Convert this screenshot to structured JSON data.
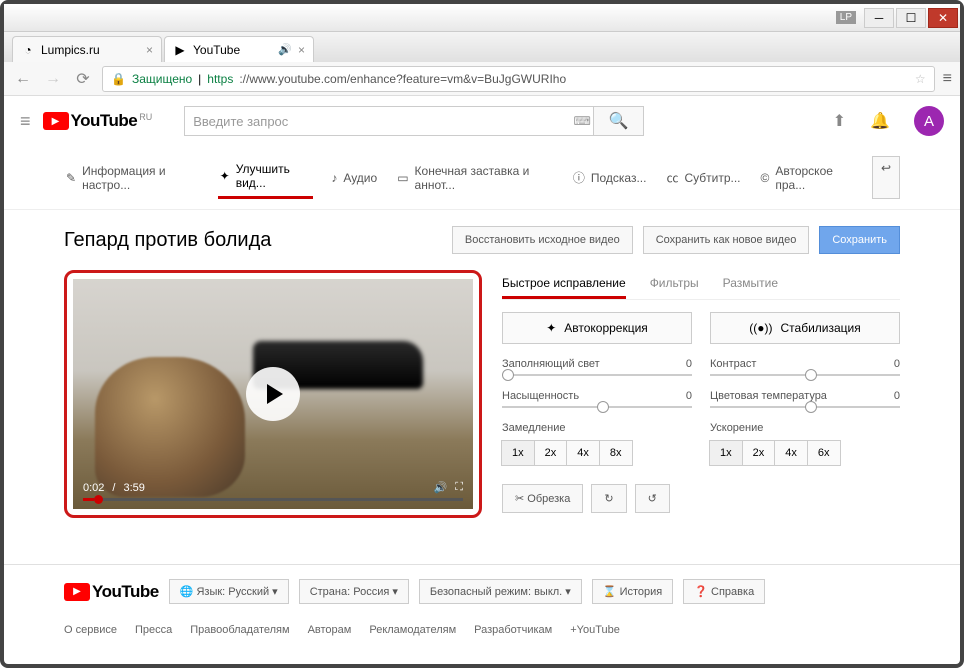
{
  "window": {
    "lp_badge": "LP"
  },
  "tabs": [
    {
      "title": "Lumpics.ru",
      "active": false
    },
    {
      "title": "YouTube",
      "active": true,
      "audio": true
    }
  ],
  "addr": {
    "secure_label": "Защищено",
    "url_host": "https",
    "url_rest": "://www.youtube.com/enhance?feature=vm&v=BuJgGWURIho"
  },
  "yt": {
    "logo_text": "YouTube",
    "region": "RU",
    "search_placeholder": "Введите запрос",
    "avatar_letter": "A"
  },
  "editor_tabs": {
    "info": "Информация и настро...",
    "enhance": "Улучшить вид...",
    "audio": "Аудио",
    "endscreen": "Конечная заставка и аннот...",
    "cards": "Подсказ...",
    "subtitles": "Субтитр...",
    "copyright": "Авторское пра..."
  },
  "video": {
    "title": "Гепард против болида",
    "restore_btn": "Восстановить исходное видео",
    "save_as_new_btn": "Сохранить как новое видео",
    "save_btn": "Сохранить",
    "current_time": "0:02",
    "duration": "3:59"
  },
  "fix_tabs": {
    "quick": "Быстрое исправление",
    "filters": "Фильтры",
    "blur": "Размытие"
  },
  "controls": {
    "autocorrect": "Автокоррекция",
    "stabilize": "Стабилизация",
    "fill_light": {
      "label": "Заполняющий свет",
      "value": "0"
    },
    "contrast": {
      "label": "Контраст",
      "value": "0"
    },
    "saturation": {
      "label": "Насыщенность",
      "value": "0"
    },
    "color_temp": {
      "label": "Цветовая температура",
      "value": "0"
    },
    "slowdown": {
      "label": "Замедление",
      "options": [
        "1x",
        "2x",
        "4x",
        "8x"
      ]
    },
    "speedup": {
      "label": "Ускорение",
      "options": [
        "1x",
        "2x",
        "4x",
        "6x"
      ]
    },
    "trim": "Обрезка"
  },
  "footer": {
    "logo": "YouTube",
    "lang_label": "Язык:",
    "lang_value": "Русский",
    "country_label": "Страна:",
    "country_value": "Россия",
    "safety_label": "Безопасный режим:",
    "safety_value": "выкл.",
    "history": "История",
    "help": "Справка",
    "links": [
      "О сервисе",
      "Пресса",
      "Правообладателям",
      "Авторам",
      "Рекламодателям",
      "Разработчикам",
      "+YouTube"
    ]
  }
}
